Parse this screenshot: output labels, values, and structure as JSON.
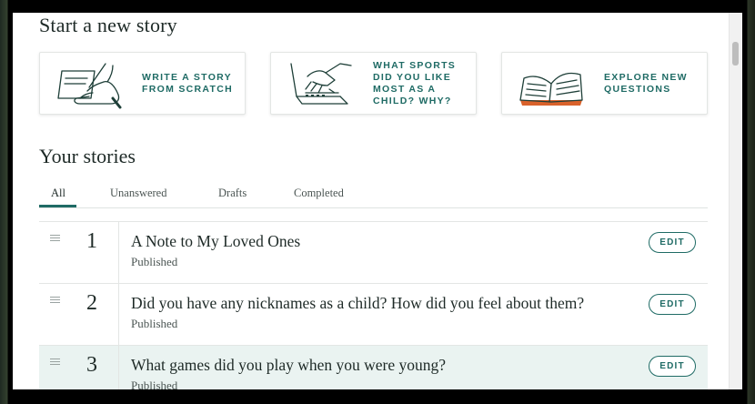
{
  "new_story": {
    "heading": "Start a new story",
    "cards": [
      {
        "label": "WRITE A STORY FROM SCRATCH",
        "icon": "handwriting-icon"
      },
      {
        "label": "WHAT SPORTS DID YOU LIKE MOST AS A CHILD? WHY?",
        "icon": "laptop-typing-icon"
      },
      {
        "label": "EXPLORE NEW QUESTIONS",
        "icon": "open-book-icon"
      }
    ]
  },
  "your_stories": {
    "heading": "Your stories",
    "tabs": [
      {
        "label": "All",
        "active": true
      },
      {
        "label": "Unanswered",
        "active": false
      },
      {
        "label": "Drafts",
        "active": false
      },
      {
        "label": "Completed",
        "active": false
      }
    ],
    "rows": [
      {
        "number": "1",
        "title": "A Note to My Loved Ones",
        "status": "Published",
        "edit_label": "EDIT"
      },
      {
        "number": "2",
        "title": "Did you have any nicknames as a child? How did you feel about them?",
        "status": "Published",
        "edit_label": "EDIT"
      },
      {
        "number": "3",
        "title": "What games did you play when you were young?",
        "status": "Published",
        "edit_label": "EDIT"
      }
    ]
  },
  "colors": {
    "accent": "#1f6b65",
    "text": "#1e2a27",
    "highlight_row": "#eaf3f1",
    "book_accent": "#d9622b"
  }
}
